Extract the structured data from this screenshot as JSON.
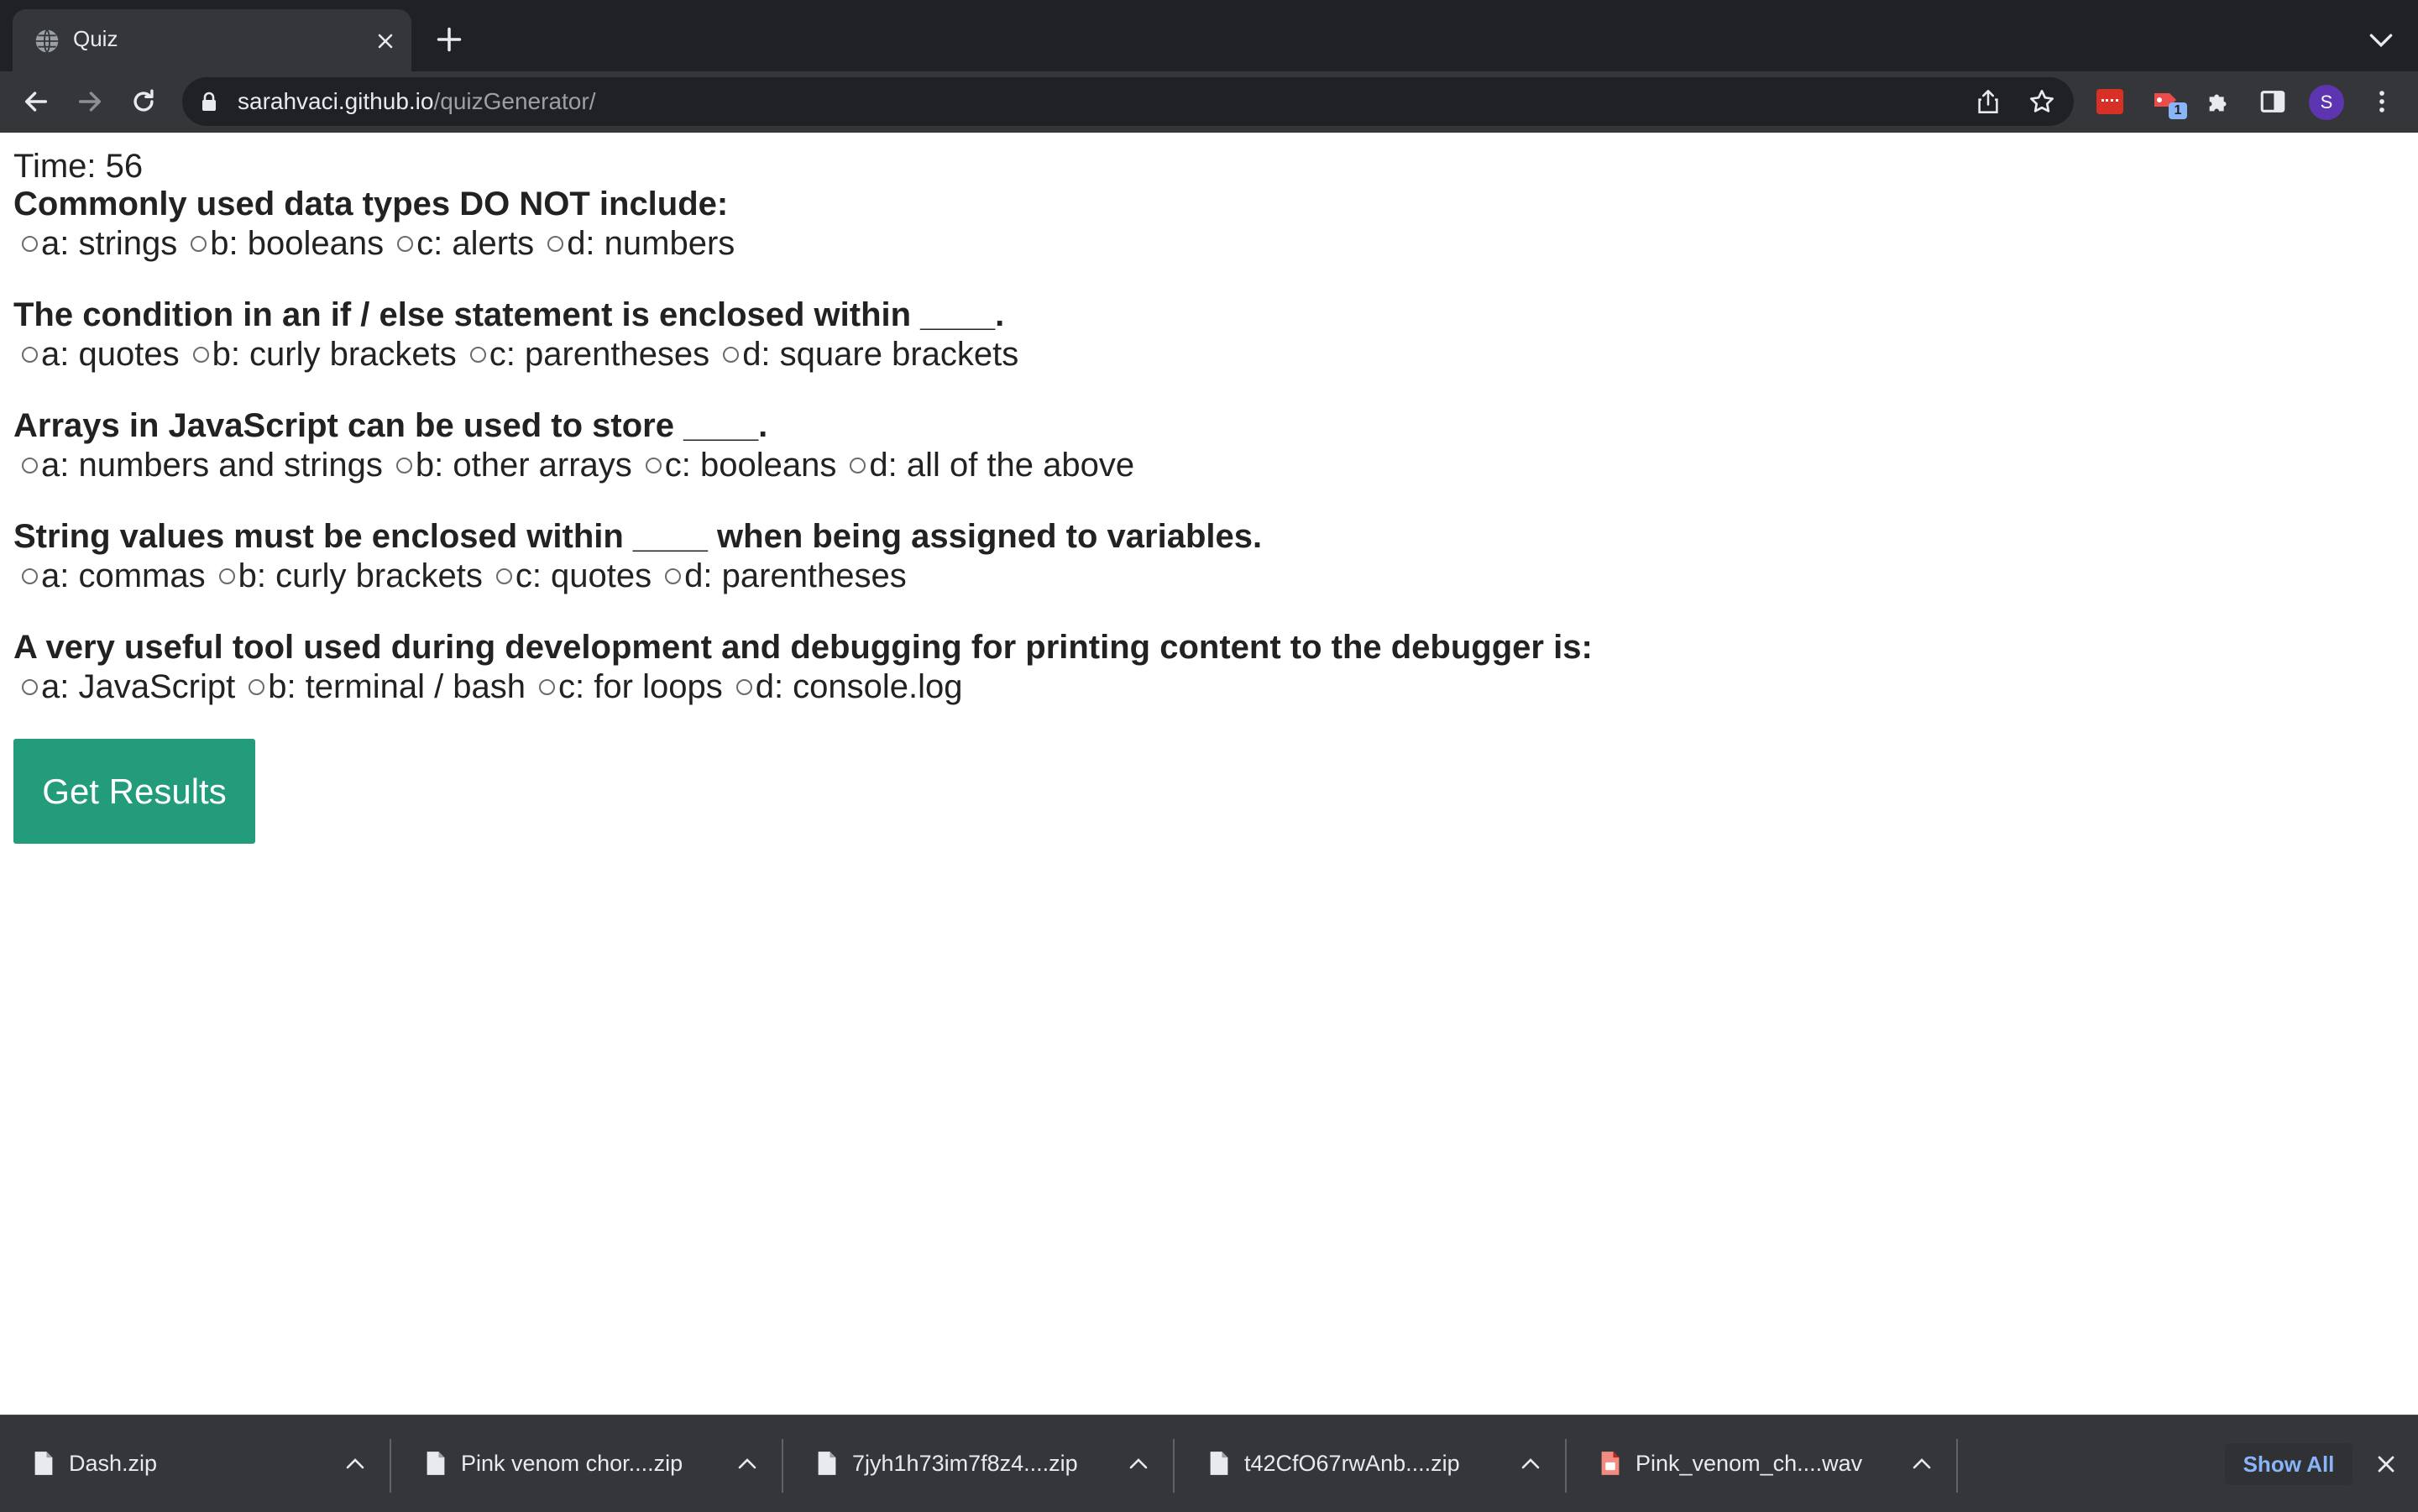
{
  "browser": {
    "tab_title": "Quiz",
    "url_host": "sarahvaci.github.io",
    "url_path": "/quizGenerator/",
    "extension_badge": "1",
    "profile_initial": "S"
  },
  "quiz": {
    "timer": "Time: 56",
    "questions": [
      {
        "text": "Commonly used data types DO NOT include:",
        "options": [
          "a: strings",
          "b: booleans",
          "c: alerts",
          "d: numbers"
        ]
      },
      {
        "text": "The condition in an if / else statement is enclosed within ____.",
        "options": [
          "a: quotes",
          "b: curly brackets",
          "c: parentheses",
          "d: square brackets"
        ]
      },
      {
        "text": "Arrays in JavaScript can be used to store ____.",
        "options": [
          "a: numbers and strings",
          "b: other arrays",
          "c: booleans",
          "d: all of the above"
        ]
      },
      {
        "text": "String values must be enclosed within ____ when being assigned to variables.",
        "options": [
          "a: commas",
          "b: curly brackets",
          "c: quotes",
          "d: parentheses"
        ]
      },
      {
        "text": "A very useful tool used during development and debugging for printing content to the debugger is:",
        "options": [
          "a: JavaScript",
          "b: terminal / bash",
          "c: for loops",
          "d: console.log"
        ]
      }
    ],
    "submit_label": "Get Results"
  },
  "downloads": {
    "items": [
      {
        "name": "Dash.zip",
        "icon": "file-icon"
      },
      {
        "name": "Pink venom chor....zip",
        "icon": "file-icon"
      },
      {
        "name": "7jyh1h73im7f8z4....zip",
        "icon": "file-icon"
      },
      {
        "name": "t42CfO67rwAnb....zip",
        "icon": "file-icon"
      },
      {
        "name": "Pink_venom_ch....wav",
        "icon": "audio-file-icon"
      }
    ],
    "show_all_label": "Show All"
  },
  "colors": {
    "submit_button": "#239c7b",
    "browser_frame": "#202124",
    "toolbar": "#35363a",
    "link_blue": "#8ab4f8"
  }
}
